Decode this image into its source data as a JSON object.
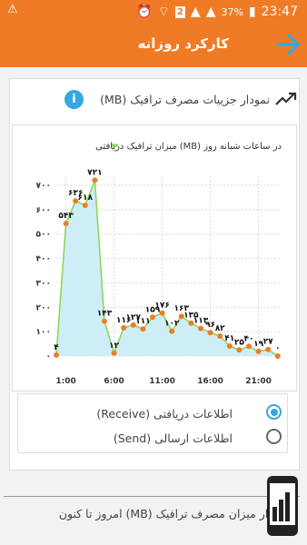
{
  "status_bar": {
    "left": "⚠",
    "sim": "2",
    "battery": "37%",
    "time": "23:47"
  },
  "app_bar": {
    "title": "کارکرد روزانه"
  },
  "card": {
    "title": "نمودار جزییات مصرف ترافیک (MB)",
    "info_icon": "i"
  },
  "chart_data": {
    "type": "line",
    "legend": "میزان ترافیک دریافتی (MB) در ساعات شبانه روز",
    "x": [
      0,
      1,
      2,
      3,
      4,
      5,
      6,
      7,
      8,
      9,
      10,
      11,
      12,
      13,
      14,
      15,
      16,
      17,
      18,
      19,
      20,
      21,
      22,
      23
    ],
    "values": [
      4,
      543,
      636,
      618,
      721,
      143,
      12,
      116,
      127,
      111,
      159,
      176,
      102,
      163,
      135,
      113,
      96,
      82,
      41,
      25,
      40,
      19,
      27,
      0
    ],
    "value_labels": [
      "۴",
      "۵۴۳",
      "۶۳۶",
      "۶۱۸",
      "۷۲۱",
      "۱۴۳",
      "۱۲",
      "۱۱۶",
      "۱۲۷",
      "۱۱۱",
      "۱۵۹",
      "۱۷۶",
      "۱۰۲",
      "۱۶۳",
      "۱۳۵",
      "۱۱۳",
      "۹۶",
      "۸۲",
      "۴۱",
      "۲۵",
      "۴۰",
      "۱۹",
      "۲۷",
      "۰"
    ],
    "ylim": [
      0,
      700
    ],
    "yticks": [
      0,
      100,
      200,
      300,
      400,
      500,
      600,
      700
    ],
    "ytick_labels": [
      "۰",
      "۱۰۰",
      "۲۰۰",
      "۳۰۰",
      "۴۰۰",
      "۵۰۰",
      "۶۰۰",
      "۷۰۰"
    ],
    "xticks": [
      1,
      6,
      11,
      16,
      21
    ],
    "xtick_labels": [
      "1:00",
      "6:00",
      "11:00",
      "16:00",
      "21:00"
    ],
    "line_color": "#8fd65a",
    "fill_color": "#cdeef6",
    "marker_color": "#f07b26"
  },
  "radio": {
    "receive": "اطلاعات دریافتی (Receive)",
    "send": "اطلاعات ارسالی (Send)",
    "selected": "receive"
  },
  "section2": {
    "title": "نمودار میزان مصرف ترافیک (MB) امروز تا کنون"
  },
  "colors": {
    "brand": "#f07b26",
    "accent": "#35a8e0"
  }
}
